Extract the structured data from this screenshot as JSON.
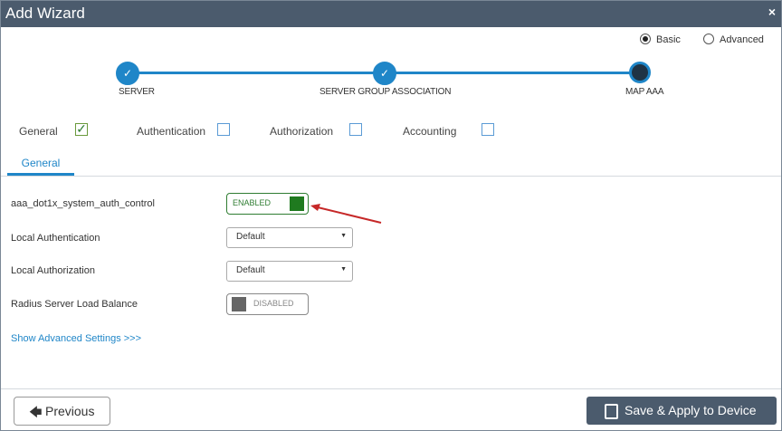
{
  "window": {
    "title": "Add Wizard",
    "close_glyph": "×"
  },
  "mode": {
    "basic": "Basic",
    "advanced": "Advanced",
    "selected": "Basic"
  },
  "steps": [
    {
      "label": "SERVER",
      "state": "done"
    },
    {
      "label": "SERVER GROUP ASSOCIATION",
      "state": "done"
    },
    {
      "label": "MAP AAA",
      "state": "current"
    }
  ],
  "step_done_glyph": "✓",
  "check_tabs": [
    {
      "label": "General",
      "checked": true
    },
    {
      "label": "Authentication",
      "checked": false
    },
    {
      "label": "Authorization",
      "checked": false
    },
    {
      "label": "Accounting",
      "checked": false
    }
  ],
  "check_glyph": "✓",
  "subtab": {
    "label": "General"
  },
  "fields": {
    "auth_control": {
      "label": "aaa_dot1x_system_auth_control",
      "state": "ENABLED"
    },
    "local_authentication": {
      "label": "Local Authentication",
      "value": "Default"
    },
    "local_authorization": {
      "label": "Local Authorization",
      "value": "Default"
    },
    "radius_load_balance": {
      "label": "Radius Server Load Balance",
      "state": "DISABLED"
    }
  },
  "select_caret": "▼",
  "advanced_link": "Show Advanced Settings >>>",
  "footer": {
    "previous": "Previous",
    "previous_arrow": "🡄",
    "save": "Save & Apply to Device"
  },
  "colors": {
    "titlebar": "#4b5b6d",
    "accent_blue": "#1f86c8",
    "enabled_green": "#1f7a1f",
    "disabled_gray": "#666666",
    "annotation_arrow": "#c62828"
  }
}
